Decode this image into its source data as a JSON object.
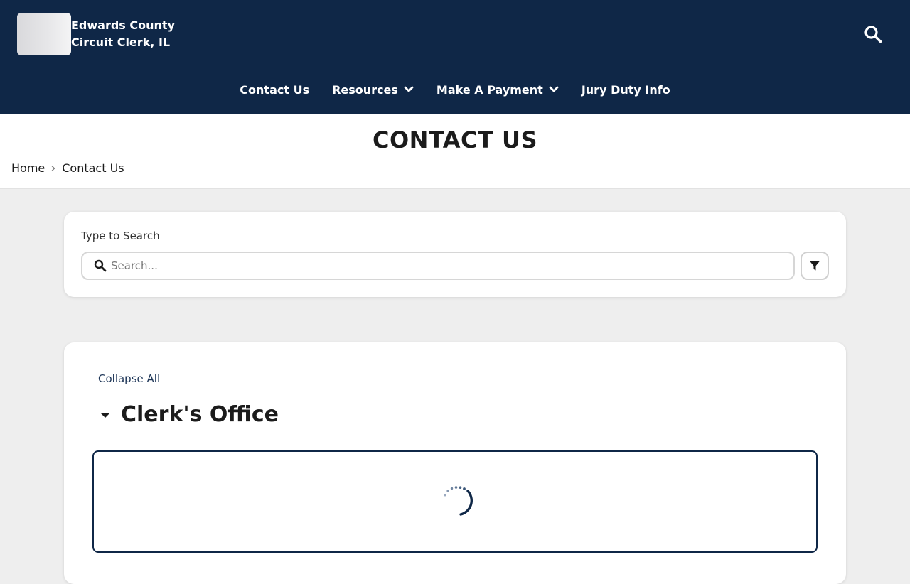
{
  "header": {
    "site_title": "Edwards County Circuit Clerk, IL",
    "search_icon": "search-icon"
  },
  "nav": {
    "items": [
      {
        "label": "Contact Us",
        "has_dropdown": false
      },
      {
        "label": "Resources",
        "has_dropdown": true
      },
      {
        "label": "Make A Payment",
        "has_dropdown": true
      },
      {
        "label": "Jury Duty Info",
        "has_dropdown": false
      }
    ]
  },
  "page": {
    "title": "CONTACT US",
    "breadcrumb": [
      "Home",
      "Contact Us"
    ]
  },
  "search": {
    "label": "Type to Search",
    "placeholder": "Search...",
    "value": "",
    "filter_icon": "filter-icon"
  },
  "directory": {
    "collapse_all_label": "Collapse All",
    "sections": [
      {
        "title": "Clerk's Office",
        "expanded": true,
        "loading": true
      }
    ]
  },
  "colors": {
    "header_bg": "#0f2747",
    "page_bg": "#eeeeee",
    "accent": "#1d3557"
  }
}
